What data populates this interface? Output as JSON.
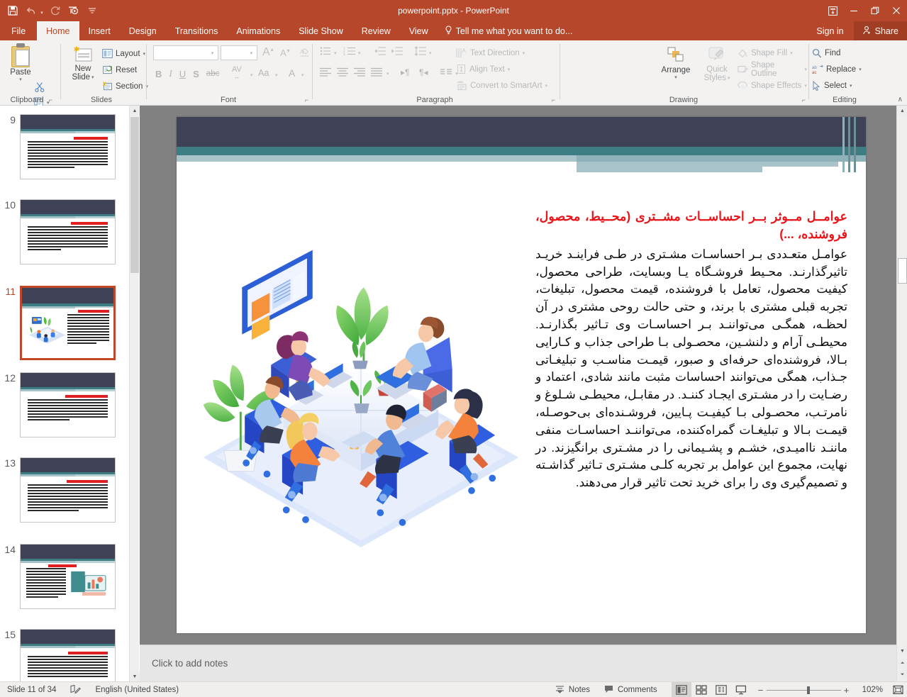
{
  "titlebar": {
    "document_title": "powerpoint.pptx - PowerPoint",
    "qat": [
      {
        "name": "save-button",
        "glyph": "ὋE"
      },
      {
        "name": "undo-button",
        "glyph": "↶"
      },
      {
        "name": "redo-button",
        "glyph": "↻"
      },
      {
        "name": "start-from-beginning-button",
        "glyph": "▶"
      },
      {
        "name": "customize-quick-access-toolbar-button",
        "glyph": "≡"
      }
    ],
    "window_controls": {
      "ribbon_display_options": "❐",
      "minimize": "–",
      "restore": "❐",
      "close": "✕"
    }
  },
  "tabs": [
    {
      "label": "File",
      "active": false
    },
    {
      "label": "Home",
      "active": true
    },
    {
      "label": "Insert",
      "active": false
    },
    {
      "label": "Design",
      "active": false
    },
    {
      "label": "Transitions",
      "active": false
    },
    {
      "label": "Animations",
      "active": false
    },
    {
      "label": "Slide Show",
      "active": false
    },
    {
      "label": "Review",
      "active": false
    },
    {
      "label": "View",
      "active": false
    }
  ],
  "tellme": {
    "placeholder": "Tell me what you want to do..."
  },
  "account": {
    "signin_label": "Sign in",
    "share_label": "Share"
  },
  "ribbon": {
    "groups": [
      {
        "name": "clipboard",
        "label": "Clipboard"
      },
      {
        "name": "slides",
        "label": "Slides"
      },
      {
        "name": "font",
        "label": "Font"
      },
      {
        "name": "paragraph",
        "label": "Paragraph"
      },
      {
        "name": "drawing",
        "label": "Drawing"
      },
      {
        "name": "editing",
        "label": "Editing"
      }
    ],
    "clipboard": {
      "paste_label": "Paste",
      "cut_title": "Cut",
      "copy_title": "Copy",
      "format_painter_title": "Format Painter"
    },
    "slides": {
      "new_slide_label_line1": "New",
      "new_slide_label_line2": "Slide",
      "layout_label": "Layout",
      "reset_label": "Reset",
      "section_label": "Section"
    },
    "font": {
      "font_name_value": "",
      "font_size_value": "",
      "grow_font": "A",
      "shrink_font": "A",
      "clear_formatting": "Clear All Formatting",
      "bold": "B",
      "italic": "I",
      "underline": "U",
      "shadow": "S",
      "strikethrough": "abc",
      "character_spacing": "AV",
      "change_case": "Aa",
      "font_color": "A"
    },
    "paragraph": {
      "text_direction_label": "Text Direction",
      "align_text_label": "Align Text",
      "convert_to_smartart_label": "Convert to SmartArt"
    },
    "drawing": {
      "arrange_label": "Arrange",
      "quick_styles_label_line1": "Quick",
      "quick_styles_label_line2": "Styles",
      "shape_fill_label": "Shape Fill",
      "shape_outline_label": "Shape Outline",
      "shape_effects_label": "Shape Effects",
      "shapes": [
        "▤",
        "╲",
        "↗",
        "▭",
        "◯",
        "▢",
        "△",
        "⌐",
        "⤳",
        "⇨",
        "⇩",
        "⌬",
        "∿",
        "⌒",
        "∼",
        "{",
        "}",
        "☆"
      ]
    },
    "editing": {
      "find_label": "Find",
      "replace_label": "Replace",
      "select_label": "Select",
      "collapse_ribbon": "∧"
    }
  },
  "thumbnails": [
    {
      "number": "9",
      "selected": false,
      "has_image": false,
      "image_side": ""
    },
    {
      "number": "10",
      "selected": false,
      "has_image": false,
      "image_side": ""
    },
    {
      "number": "11",
      "selected": true,
      "has_image": true,
      "image_side": "left"
    },
    {
      "number": "12",
      "selected": false,
      "has_image": false,
      "image_side": ""
    },
    {
      "number": "13",
      "selected": false,
      "has_image": false,
      "image_side": ""
    },
    {
      "number": "14",
      "selected": false,
      "has_image": true,
      "image_side": "right"
    },
    {
      "number": "15",
      "selected": false,
      "has_image": false,
      "image_side": ""
    }
  ],
  "slide": {
    "title": "عوامــل مــوثر بــر احساســات مشــتری (محــیط، محصول، فروشنده، ...)",
    "body": "عوامـل متعـددی بـر احساسـات مشـتری در طـی فراینـد خریـد تاثیرگذارنـد. محـیط فروشـگاه یـا وبسایت، طراحی محصول، کیفیت محصول، تعامل با فروشنده، قیمت محصول، تبلیغات، تجربه قبلی مشتری با برند، و حتی حالت روحی مشتری در آن لحظـه، همگـی می‌تواننـد بـر احساسـات وی تـاثیر بگذارنـد. محیطـی آرام و دلنشـین، محصـولی بـا طراحی جذاب و کـارایی بـالا، فروشنده‌ای حرفه‌ای و صبور، قیمـت مناسـب و تبلیغـاتی جـذاب، همگی می‌توانند احساسات مثبت مانند شادی، اعتماد و رضـایت را در مشـتری ایجـاد کننـد. در مقابـل، محیطـی شـلوغ و نامرتـب، محصـولی بـا کیفیـت پـایین، فروشـنده‌ای بی‌حوصـله، قیمـت بـالا و تبلیغـات گمراه‌کننده، می‌تواننـد احساسـات منفی ماننـد ناامیـدی، خشـم و پشـیمانی را در مشـتری برانگیزند. در نهایت، مجموع این عوامل بر تجربه کلـی مشـتری تـاثیر گذاشـته و تصمیم‌گیری وی را برای خرید تحت تاثیر قرار می‌دهند.",
    "illustration_name": "isometric-office-team-meeting-illustration"
  },
  "notes": {
    "placeholder": "Click to add notes"
  },
  "statusbar": {
    "slide_indicator": "Slide 11 of 34",
    "language": "English (United States)",
    "notes_label": "Notes",
    "comments_label": "Comments",
    "views": [
      {
        "name": "normal-view",
        "glyph": "▤",
        "active": true
      },
      {
        "name": "slide-sorter-view",
        "glyph": "⌸",
        "active": false
      },
      {
        "name": "reading-view",
        "glyph": "▥",
        "active": false
      },
      {
        "name": "slide-show-view",
        "glyph": "☐",
        "active": false
      }
    ],
    "zoom_out": "−",
    "zoom_in": "+",
    "zoom_level": "102%",
    "fit_to_window": "⛶"
  },
  "colors": {
    "brand_red": "#b7472a",
    "title_red": "#e8151b",
    "deco_dark": "#3f4257",
    "deco_teal": "#3d7e85",
    "ribbon_bg": "#f3f2f1",
    "canvas_gray": "#818181"
  }
}
